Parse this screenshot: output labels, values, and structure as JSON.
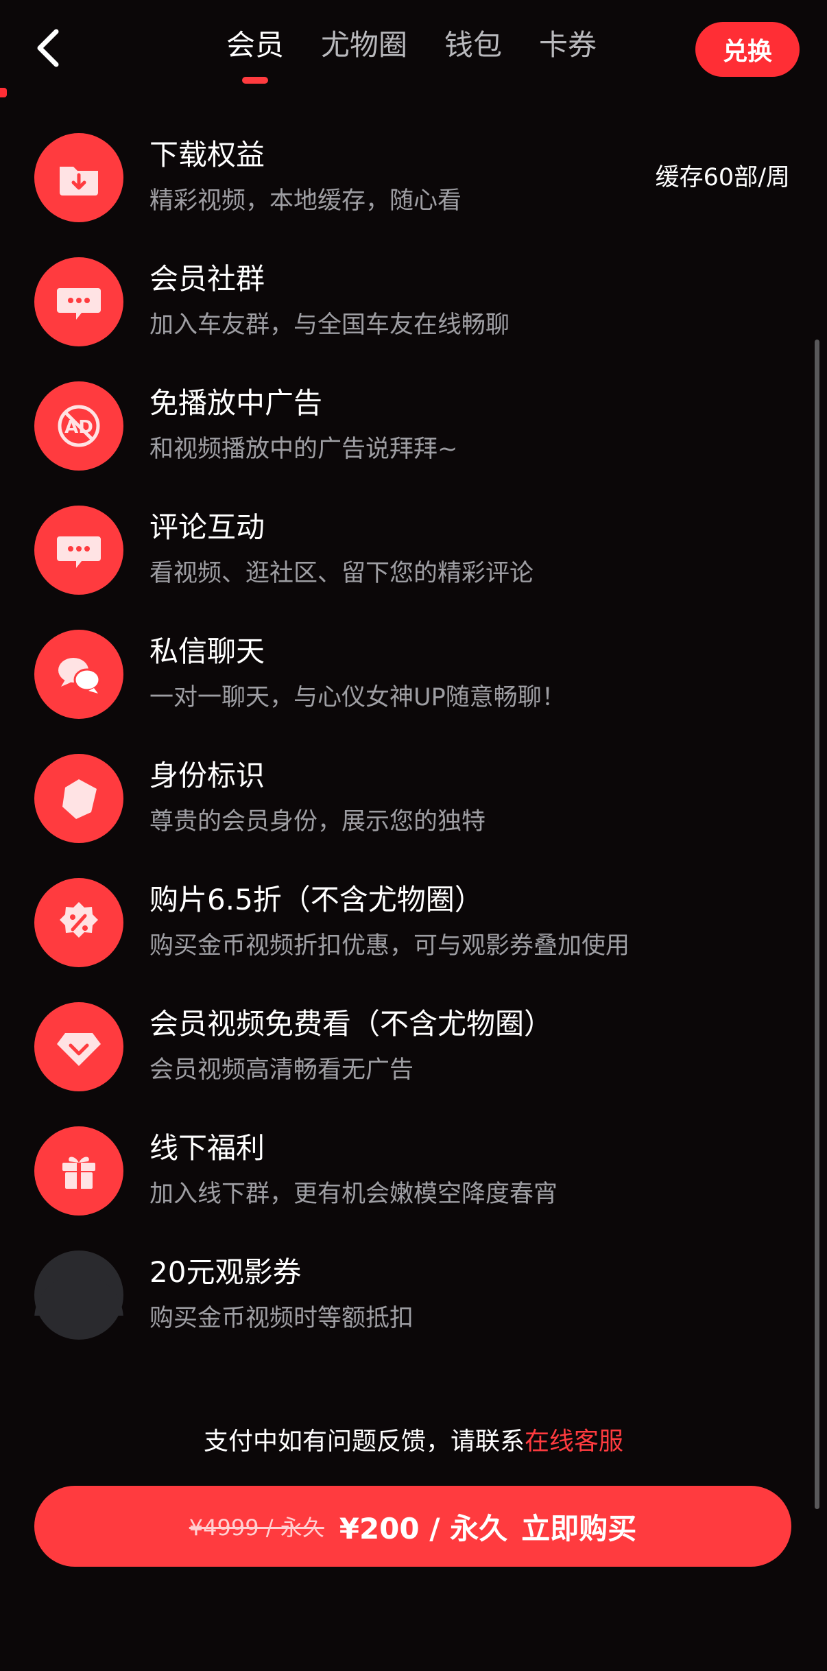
{
  "colors": {
    "background": "#0b0708",
    "accent": "#ff3b3f",
    "text_primary": "#ffffff",
    "text_secondary": "#9e9ea3",
    "icon_muted": "#2a2a2e"
  },
  "header": {
    "back_icon": "chevron-left-icon",
    "tabs": [
      {
        "label": "会员",
        "active": true
      },
      {
        "label": "尤物圈",
        "active": false
      },
      {
        "label": "钱包",
        "active": false
      },
      {
        "label": "卡券",
        "active": false
      }
    ],
    "redeem_label": "兑换"
  },
  "benefits": [
    {
      "icon": "download-folder-icon",
      "title": "下载权益",
      "desc": "精彩视频，本地缓存，随心看",
      "badge": "缓存60部/周"
    },
    {
      "icon": "group-chat-icon",
      "title": "会员社群",
      "desc": "加入车友群，与全国车友在线畅聊"
    },
    {
      "icon": "no-ads-icon",
      "title": "免播放中广告",
      "desc": "和视频播放中的广告说拜拜~"
    },
    {
      "icon": "comment-icon",
      "title": "评论互动",
      "desc": "看视频、逛社区、留下您的精彩评论"
    },
    {
      "icon": "private-message-icon",
      "title": "私信聊天",
      "desc": "一对一聊天，与心仪女神UP随意畅聊！"
    },
    {
      "icon": "identity-badge-icon",
      "title": "身份标识",
      "desc": "尊贵的会员身份，展示您的独特"
    },
    {
      "icon": "discount-icon",
      "title": "购片6.5折（不含尤物圈）",
      "desc": "购买金币视频折扣优惠，可与观影券叠加使用"
    },
    {
      "icon": "diamond-icon",
      "title": "会员视频免费看（不含尤物圈）",
      "desc": "会员视频高清畅看无广告"
    },
    {
      "icon": "gift-icon",
      "title": "线下福利",
      "desc": "加入线下群，更有机会嫩模空降度春宵"
    },
    {
      "icon": "ticket-icon",
      "title": "20元观影券",
      "desc": "购买金币视频时等额抵扣",
      "muted": true
    }
  ],
  "footer": {
    "support_text": "支付中如有问题反馈，请联系",
    "support_link": "在线客服",
    "original_price": "¥4999 / 永久",
    "current_price": "¥200 / 永久",
    "buy_label": "立即购买"
  }
}
